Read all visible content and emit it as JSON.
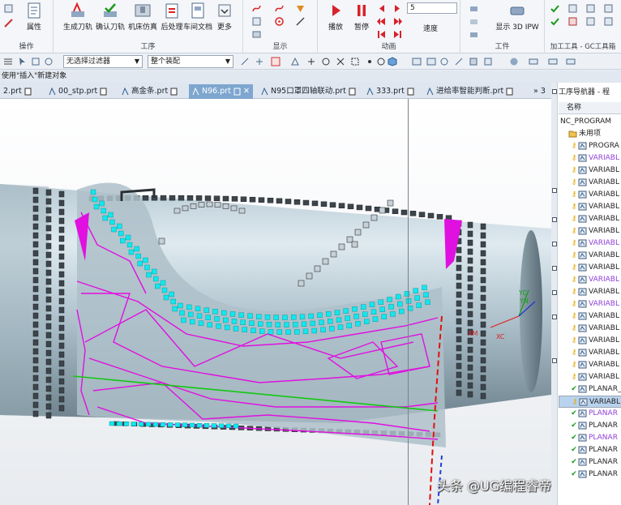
{
  "ribbon": {
    "groups": [
      {
        "label": "操作",
        "buttons": [
          "属性"
        ]
      },
      {
        "label": "工序",
        "buttons": [
          "生成刀轨",
          "确认刀轨",
          "机床仿真",
          "后处理",
          "车间文档",
          "更多"
        ]
      },
      {
        "label": "显示",
        "buttons": []
      },
      {
        "label": "动画",
        "buttons": [
          "播放",
          "暂停"
        ]
      },
      {
        "label": "工件",
        "buttons": [
          "显示 3D IPW"
        ]
      },
      {
        "label": "加工工具 - GC工具箱",
        "buttons": []
      }
    ],
    "speed_value": "5",
    "speed_label": "速度"
  },
  "toolbar2": {
    "filter": "无选择过滤器",
    "assembly": "整个装配"
  },
  "hint": "使用\"插入\"新建对象",
  "tabs": [
    {
      "label": "2.prt"
    },
    {
      "label": "00_stp.prt"
    },
    {
      "label": "高金条.prt"
    },
    {
      "label": "N96.prt"
    },
    {
      "label": "N95口罩四轴联动.prt"
    },
    {
      "label": "333.prt"
    },
    {
      "label": "进给率智能判断.prt"
    },
    {
      "label": "» 3"
    }
  ],
  "viewport": {
    "axis_labels": {
      "yc": "YC",
      "yn": "YN",
      "xm": "XM",
      "xc": "XC"
    },
    "watermark": "头条 @UG编程睿帝老师"
  },
  "navigator": {
    "title": "工序导航器 - 程",
    "column_name": "名称",
    "root": "NC_PROGRAM",
    "unused": "未用项",
    "rows": [
      {
        "text": "PROGRA",
        "mark": "",
        "color": "#222222"
      },
      {
        "text": "VARIABL",
        "mark": "",
        "color": "#8f3fd8"
      },
      {
        "text": "VARIABL",
        "mark": "",
        "color": "#222222"
      },
      {
        "text": "VARIABL",
        "mark": "",
        "color": "#222222"
      },
      {
        "text": "VARIABL",
        "mark": "",
        "color": "#222222"
      },
      {
        "text": "VARIABL",
        "mark": "",
        "color": "#222222"
      },
      {
        "text": "VARIABL",
        "mark": "",
        "color": "#222222"
      },
      {
        "text": "VARIABL",
        "mark": "",
        "color": "#222222"
      },
      {
        "text": "VARIABL",
        "mark": "",
        "color": "#8f3fd8"
      },
      {
        "text": "VARIABL",
        "mark": "",
        "color": "#222222"
      },
      {
        "text": "VARIABL",
        "mark": "",
        "color": "#222222"
      },
      {
        "text": "VARIABL",
        "mark": "",
        "color": "#8f3fd8"
      },
      {
        "text": "VARIABL",
        "mark": "",
        "color": "#222222"
      },
      {
        "text": "VARIABL",
        "mark": "",
        "color": "#8f3fd8"
      },
      {
        "text": "VARIABL",
        "mark": "",
        "color": "#222222"
      },
      {
        "text": "VARIABL",
        "mark": "",
        "color": "#222222"
      },
      {
        "text": "VARIABL",
        "mark": "",
        "color": "#222222"
      },
      {
        "text": "VARIABL",
        "mark": "",
        "color": "#222222"
      },
      {
        "text": "VARIABL",
        "mark": "",
        "color": "#222222"
      },
      {
        "text": "VARIABL",
        "mark": "",
        "color": "#222222"
      },
      {
        "text": "PLANAR_",
        "mark": "✔",
        "color": "#222222"
      },
      {
        "text": "VARIABL",
        "mark": "",
        "color": "#222222",
        "selected": true
      },
      {
        "text": "PLANAR",
        "mark": "✔",
        "color": "#8f3fd8"
      },
      {
        "text": "PLANAR",
        "mark": "✔",
        "color": "#222222"
      },
      {
        "text": "PLANAR",
        "mark": "✔",
        "color": "#8f3fd8"
      },
      {
        "text": "PLANAR",
        "mark": "✔",
        "color": "#222222"
      },
      {
        "text": "PLANAR",
        "mark": "✔",
        "color": "#222222"
      },
      {
        "text": "PLANAR",
        "mark": "✔",
        "color": "#222222"
      }
    ]
  },
  "colors": {
    "toolpath": "#e010e0",
    "cyan": "#10e8ee",
    "part": "#c9d8e0",
    "tab_active": "#7ea6cf"
  }
}
